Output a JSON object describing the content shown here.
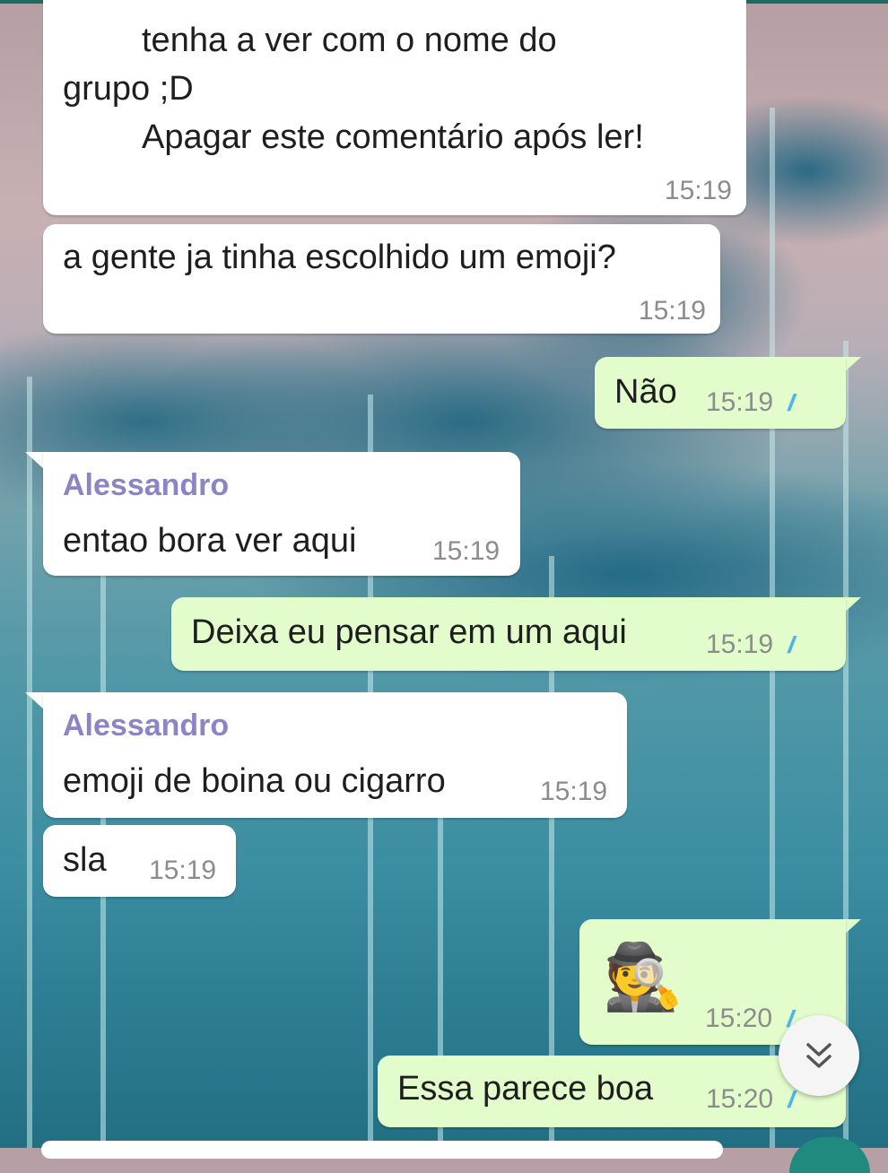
{
  "messages": {
    "m1": {
      "line1": "tenha a ver com o nome do",
      "line2": "grupo ;D",
      "line3": "Apagar este comentário após ler!",
      "time": "15:19"
    },
    "m2": {
      "text": "a gente ja tinha escolhido um emoji?",
      "time": "15:19"
    },
    "m3": {
      "text": "Não",
      "time": "15:19",
      "ticks": "//"
    },
    "m4": {
      "sender": "Alessandro",
      "text": "entao bora ver aqui",
      "time": "15:19"
    },
    "m5": {
      "text": "Deixa eu pensar em um aqui",
      "time": "15:19",
      "ticks": "//"
    },
    "m6": {
      "sender": "Alessandro",
      "text": "emoji de boina ou cigarro",
      "time": "15:19"
    },
    "m7": {
      "text": "sla",
      "time": "15:19"
    },
    "m8": {
      "emoji": "🕵️",
      "emoji_name": "detective-emoji",
      "time": "15:20",
      "ticks": "//"
    },
    "m9": {
      "text": "Essa parece boa",
      "time": "15:20",
      "ticks": "//"
    }
  },
  "scroll_button": {
    "icon": "chevron-double-down-icon"
  },
  "colors": {
    "incoming_bubble": "#ffffff",
    "outgoing_bubble": "#e2fdcb",
    "sender_name": "#8a86c6",
    "read_ticks": "#4fb3f0",
    "timestamp": "#8c8c8c"
  }
}
